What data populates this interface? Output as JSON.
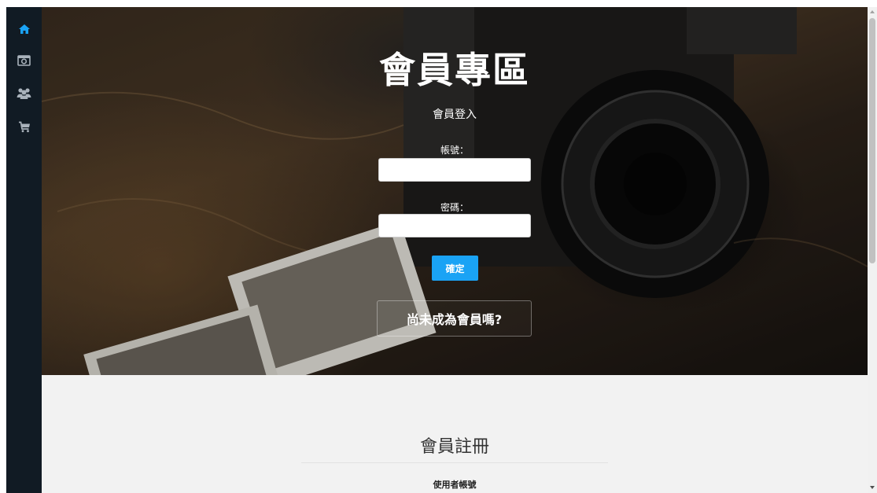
{
  "sidebar": {
    "items": [
      {
        "icon": "home-icon",
        "color": "#1aa3f5"
      },
      {
        "icon": "camera-icon",
        "color": "#a9b2bb"
      },
      {
        "icon": "users-icon",
        "color": "#a9b2bb"
      },
      {
        "icon": "cart-icon",
        "color": "#a9b2bb"
      }
    ]
  },
  "hero": {
    "title": "會員專區",
    "login_heading": "會員登入",
    "account_label": "帳號：",
    "account_value": "",
    "password_label": "密碼：",
    "password_value": "",
    "confirm_label": "確定",
    "register_prompt": "尚未成為會員嗎?"
  },
  "register": {
    "title": "會員註冊",
    "username_label": "使用者帳號"
  },
  "colors": {
    "accent": "#1aa3f5",
    "sidebar_bg": "#111b24",
    "section_bg": "#f2f2f2"
  }
}
